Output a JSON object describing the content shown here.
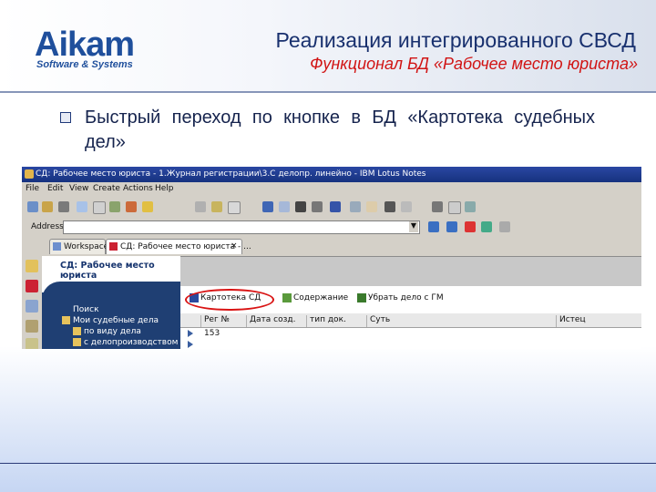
{
  "logo": {
    "name": "Aikam",
    "tagline": "Software & Systems"
  },
  "title": "Реализация интегрированного СВСД",
  "subtitle": "Функционал БД «Рабочее место юриста»",
  "bullet": {
    "text": "Быстрый переход по кнопке в БД «Картотека судебных дел»"
  },
  "screenshot": {
    "window_title": "СД: Рабочее место юриста - 1.Журнал регистрации\\3.С делопр. линейно - IBM Lotus Notes",
    "menu": [
      "File",
      "Edit",
      "View",
      "Create",
      "Actions",
      "Help"
    ],
    "address_label": "Address",
    "tabs": [
      {
        "label": "Workspace"
      },
      {
        "label": "СД: Рабочее место юриста - ..."
      }
    ],
    "nav": {
      "header": "СД: Рабочее место юриста",
      "items": [
        "Поиск",
        "Мои судебные дела",
        "по виду дела",
        "с делопроизводством"
      ]
    },
    "actions": [
      "Картотека СД",
      "Содержание",
      "Убрать дело с ГМ"
    ],
    "columns": [
      "Рег №",
      "Дата созд.",
      "тип док.",
      "Суть",
      "Истец"
    ],
    "rows": [
      {
        "reg": "153"
      },
      {
        "reg": ""
      }
    ]
  },
  "colors": {
    "brand": "#1f4f9c",
    "title": "#18306e",
    "subtitle": "#d11414",
    "nav_bg": "#1f3f73",
    "highlight": "#d91414"
  }
}
